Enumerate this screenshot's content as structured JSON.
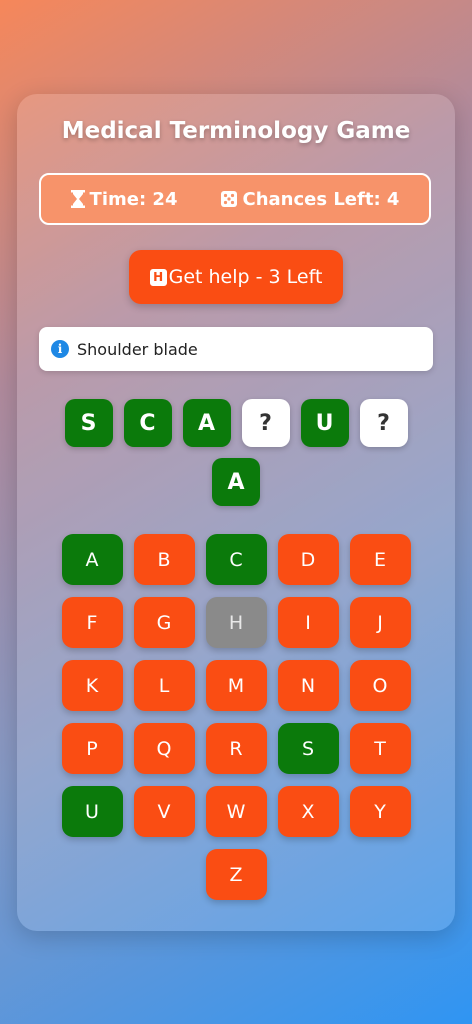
{
  "game": {
    "title": "Medical Terminology Game",
    "time_label": "Time: 24",
    "chances_label": "Chances Left: 4",
    "help_label": "Get help - 3 Left",
    "help_icon_letter": "H",
    "hint_text": "Shoulder blade"
  },
  "word_slots": [
    {
      "char": "S",
      "state": "revealed"
    },
    {
      "char": "C",
      "state": "revealed"
    },
    {
      "char": "A",
      "state": "revealed"
    },
    {
      "char": "?",
      "state": "hidden"
    },
    {
      "char": "U",
      "state": "revealed"
    },
    {
      "char": "?",
      "state": "hidden"
    },
    {
      "char": "A",
      "state": "revealed"
    }
  ],
  "keyboard": [
    {
      "letter": "A",
      "state": "correct"
    },
    {
      "letter": "B",
      "state": "unused"
    },
    {
      "letter": "C",
      "state": "correct"
    },
    {
      "letter": "D",
      "state": "unused"
    },
    {
      "letter": "E",
      "state": "unused"
    },
    {
      "letter": "F",
      "state": "unused"
    },
    {
      "letter": "G",
      "state": "unused"
    },
    {
      "letter": "H",
      "state": "disabled"
    },
    {
      "letter": "I",
      "state": "unused"
    },
    {
      "letter": "J",
      "state": "unused"
    },
    {
      "letter": "K",
      "state": "unused"
    },
    {
      "letter": "L",
      "state": "unused"
    },
    {
      "letter": "M",
      "state": "unused"
    },
    {
      "letter": "N",
      "state": "unused"
    },
    {
      "letter": "O",
      "state": "unused"
    },
    {
      "letter": "P",
      "state": "unused"
    },
    {
      "letter": "Q",
      "state": "unused"
    },
    {
      "letter": "R",
      "state": "unused"
    },
    {
      "letter": "S",
      "state": "correct"
    },
    {
      "letter": "T",
      "state": "unused"
    },
    {
      "letter": "U",
      "state": "correct"
    },
    {
      "letter": "V",
      "state": "unused"
    },
    {
      "letter": "W",
      "state": "unused"
    },
    {
      "letter": "X",
      "state": "unused"
    },
    {
      "letter": "Y",
      "state": "unused"
    },
    {
      "letter": "Z",
      "state": "unused"
    }
  ],
  "icons": {
    "timer": "hourglass-icon",
    "chances": "dice-icon",
    "help": "help-h-icon",
    "hint": "info-icon"
  },
  "colors": {
    "correct": "#0b7a0b",
    "unused": "#fa4d13",
    "disabled": "#8a8a8a",
    "stats_bg": "#f7936a"
  }
}
